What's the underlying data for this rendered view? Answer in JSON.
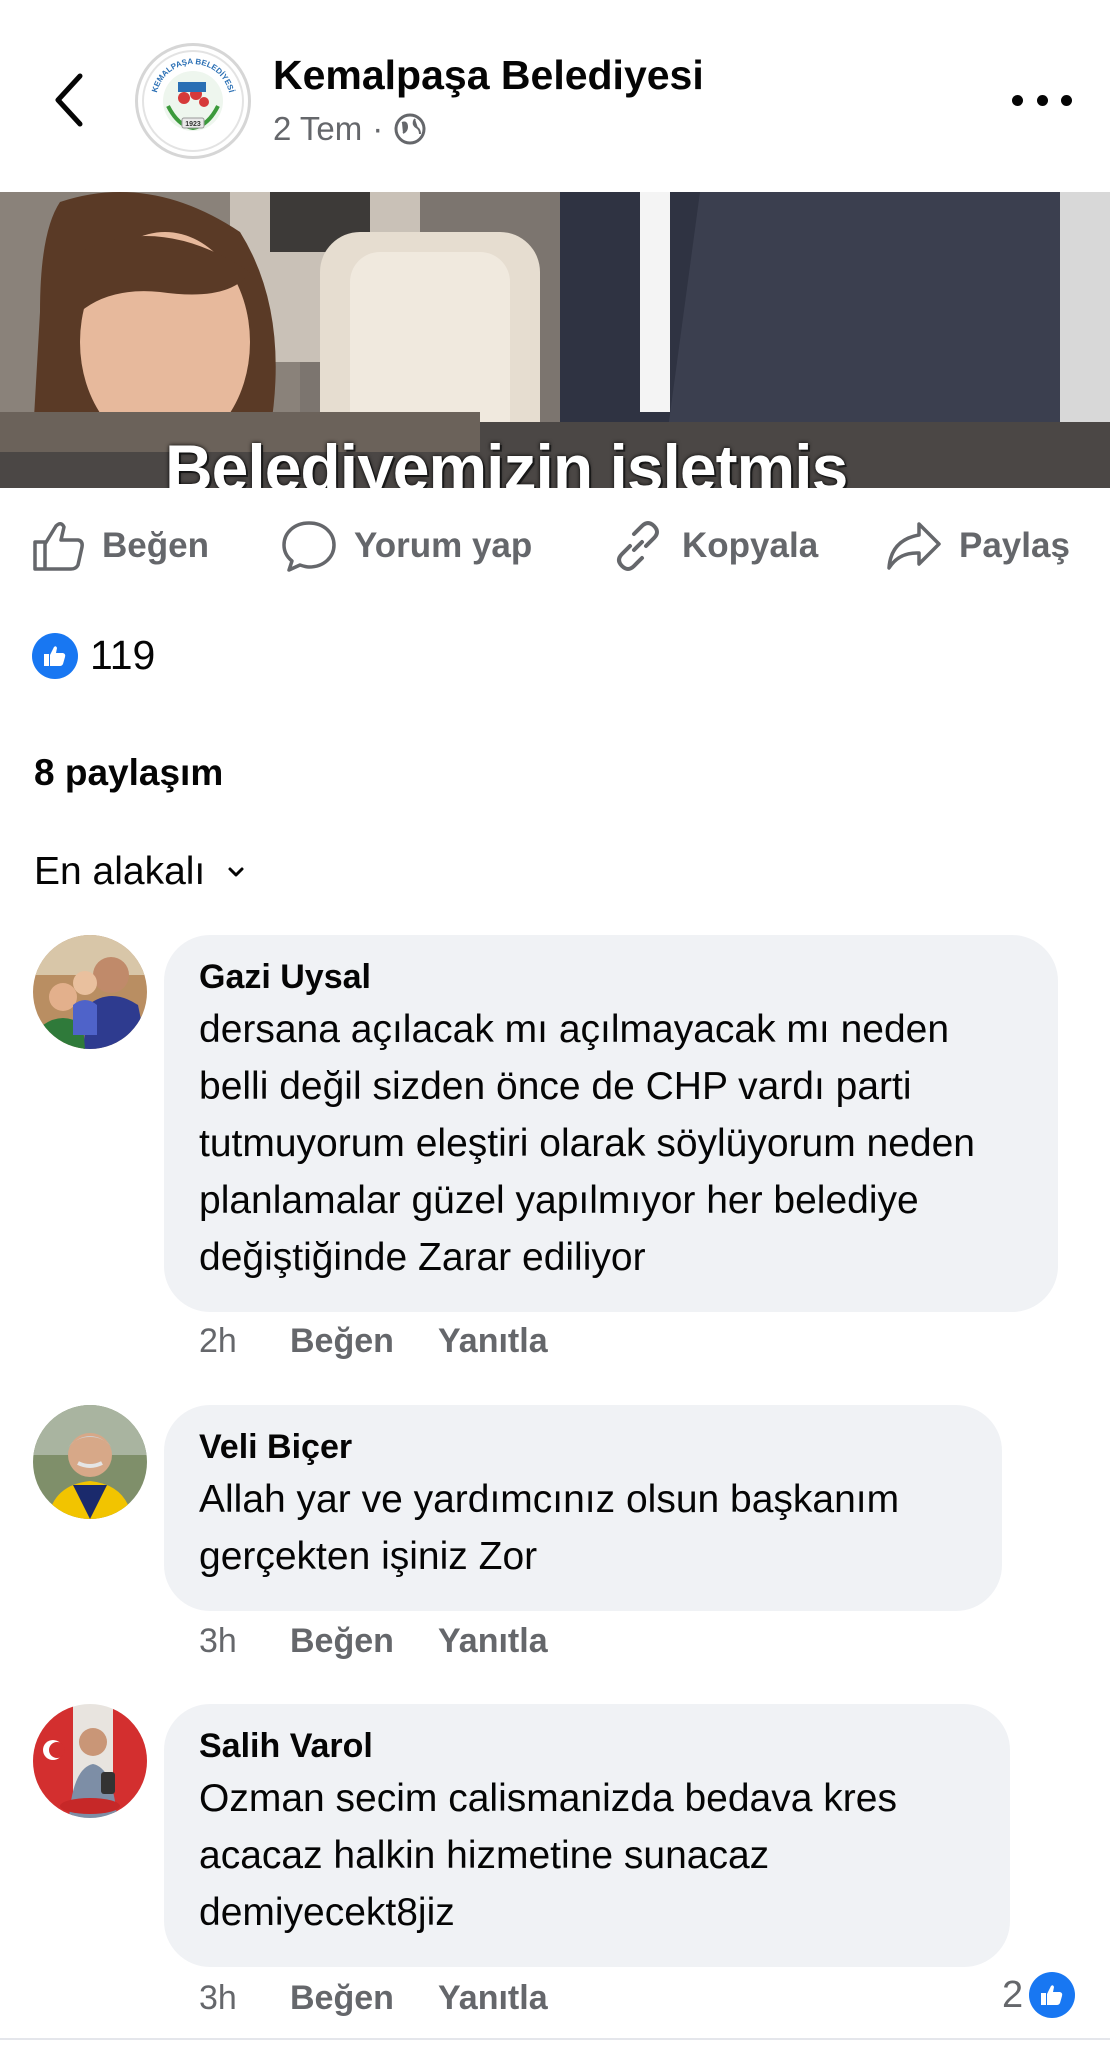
{
  "header": {
    "page_name": "Kemalpaşa Belediyesi",
    "time": "2 Tem",
    "separator": "·",
    "logo_text": "KEMALPAŞA BELEDİYESİ",
    "logo_year": "1923"
  },
  "post": {
    "caption": "Belediyemizin işletmiş"
  },
  "actions": {
    "like": "Beğen",
    "comment": "Yorum yap",
    "copy": "Kopyala",
    "share": "Paylaş"
  },
  "reactions": {
    "count": "119"
  },
  "shares": "8 paylaşım",
  "sort": {
    "label": "En alakalı"
  },
  "comments": [
    {
      "author": "Gazi Uysal",
      "text": "dersana açılacak mı açılmayacak mı neden belli değil sizden önce de CHP vardı parti tutmuyorum eleştiri olarak söylüyorum neden planlamalar güzel yapılmıyor her belediye değiştiğinde Zarar ediliyor",
      "time": "2h",
      "like": "Beğen",
      "reply": "Yanıtla"
    },
    {
      "author": "Veli Biçer",
      "text": "Allah yar ve yardımcınız olsun başkanım gerçekten işiniz Zor",
      "time": "3h",
      "like": "Beğen",
      "reply": "Yanıtla"
    },
    {
      "author": "Salih Varol",
      "text": "Ozman secim calismanizda bedava kres acacaz halkin hizmetine sunacaz demiyecekt8jiz",
      "time": "3h",
      "like": "Beğen",
      "reply": "Yanıtla",
      "reaction_count": "2"
    }
  ],
  "colors": {
    "accent": "#1877f2",
    "secondary_text": "#65676b",
    "bubble": "#f0f2f5"
  }
}
